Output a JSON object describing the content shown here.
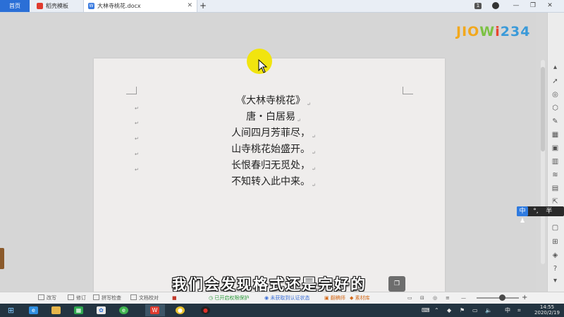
{
  "tabs": {
    "home": "首页",
    "templates": "稻壳模板",
    "document": "大林寺桃花.docx"
  },
  "window": {
    "badge": "1"
  },
  "watermark": {
    "parts": [
      "JIO",
      "W",
      "i",
      "234"
    ]
  },
  "document": {
    "lines": [
      "《大林寺桃花》",
      "唐・白居易",
      "人间四月芳菲尽，",
      "山寺桃花始盛开。",
      "长恨春归无觅处，",
      "不知转入此中来。"
    ],
    "paragraph_mark": "↵"
  },
  "subtitle": "我们会发现格式还是完好的",
  "ime": {
    "mode": "中",
    "punct": "°,",
    "width": "半"
  },
  "statusbar": {
    "items": [
      "改写",
      "修订",
      "拼写检查",
      "文档校对"
    ],
    "protect": "已开启权限保护",
    "cert": "未获取到认证状态",
    "workshop": "翻稿师",
    "materials": "素材库",
    "zoom_fill": 0.6
  },
  "taskbar": {
    "ime": "中",
    "time": "14:55",
    "date": "2020/2/19"
  },
  "colors": {
    "tab_active": "#2b6fd6",
    "cursor_highlight": "#f1e40f",
    "taskbar": "#233441"
  }
}
